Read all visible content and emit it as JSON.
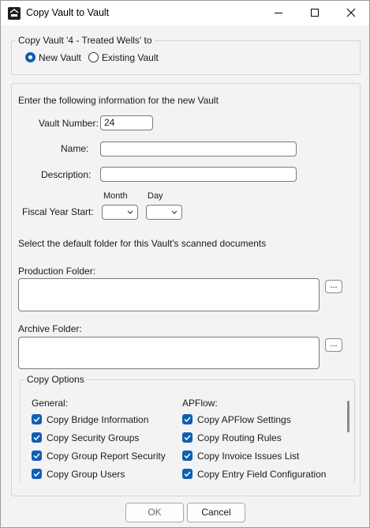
{
  "window": {
    "title": "Copy Vault to Vault"
  },
  "copy_target": {
    "legend": "Copy Vault '4 - Treated Wells' to",
    "options": [
      {
        "label": "New Vault",
        "checked": true
      },
      {
        "label": "Existing Vault",
        "checked": false
      }
    ]
  },
  "new_vault": {
    "instructions": "Enter the following information for the new Vault",
    "vault_number_label": "Vault Number:",
    "vault_number_value": "24",
    "name_label": "Name:",
    "name_value": "",
    "description_label": "Description:",
    "description_value": "",
    "fiscal_label": "Fiscal Year Start:",
    "month_label": "Month",
    "day_label": "Day",
    "month_value": "",
    "day_value": "",
    "folder_instructions": "Select the default folder for this Vault's scanned documents",
    "production_label": "Production Folder:",
    "production_value": "",
    "archive_label": "Archive Folder:",
    "archive_value": "",
    "browse_label": "..."
  },
  "copy_options": {
    "legend": "Copy Options",
    "general": {
      "heading": "General:",
      "items": [
        {
          "label": "Copy Bridge Information",
          "checked": true
        },
        {
          "label": "Copy Security Groups",
          "checked": true
        },
        {
          "label": "Copy Group Report Security",
          "checked": true
        },
        {
          "label": "Copy Group Users",
          "checked": true
        }
      ]
    },
    "apflow": {
      "heading": "APFlow:",
      "items": [
        {
          "label": "Copy APFlow Settings",
          "checked": true
        },
        {
          "label": "Copy Routing Rules",
          "checked": true
        },
        {
          "label": "Copy Invoice Issues List",
          "checked": true
        },
        {
          "label": "Copy Entry Field Configuration",
          "checked": true
        }
      ]
    }
  },
  "buttons": {
    "ok": "OK",
    "cancel": "Cancel"
  },
  "colors": {
    "accent": "#0f5fb3",
    "background": "#f3f3f3"
  }
}
